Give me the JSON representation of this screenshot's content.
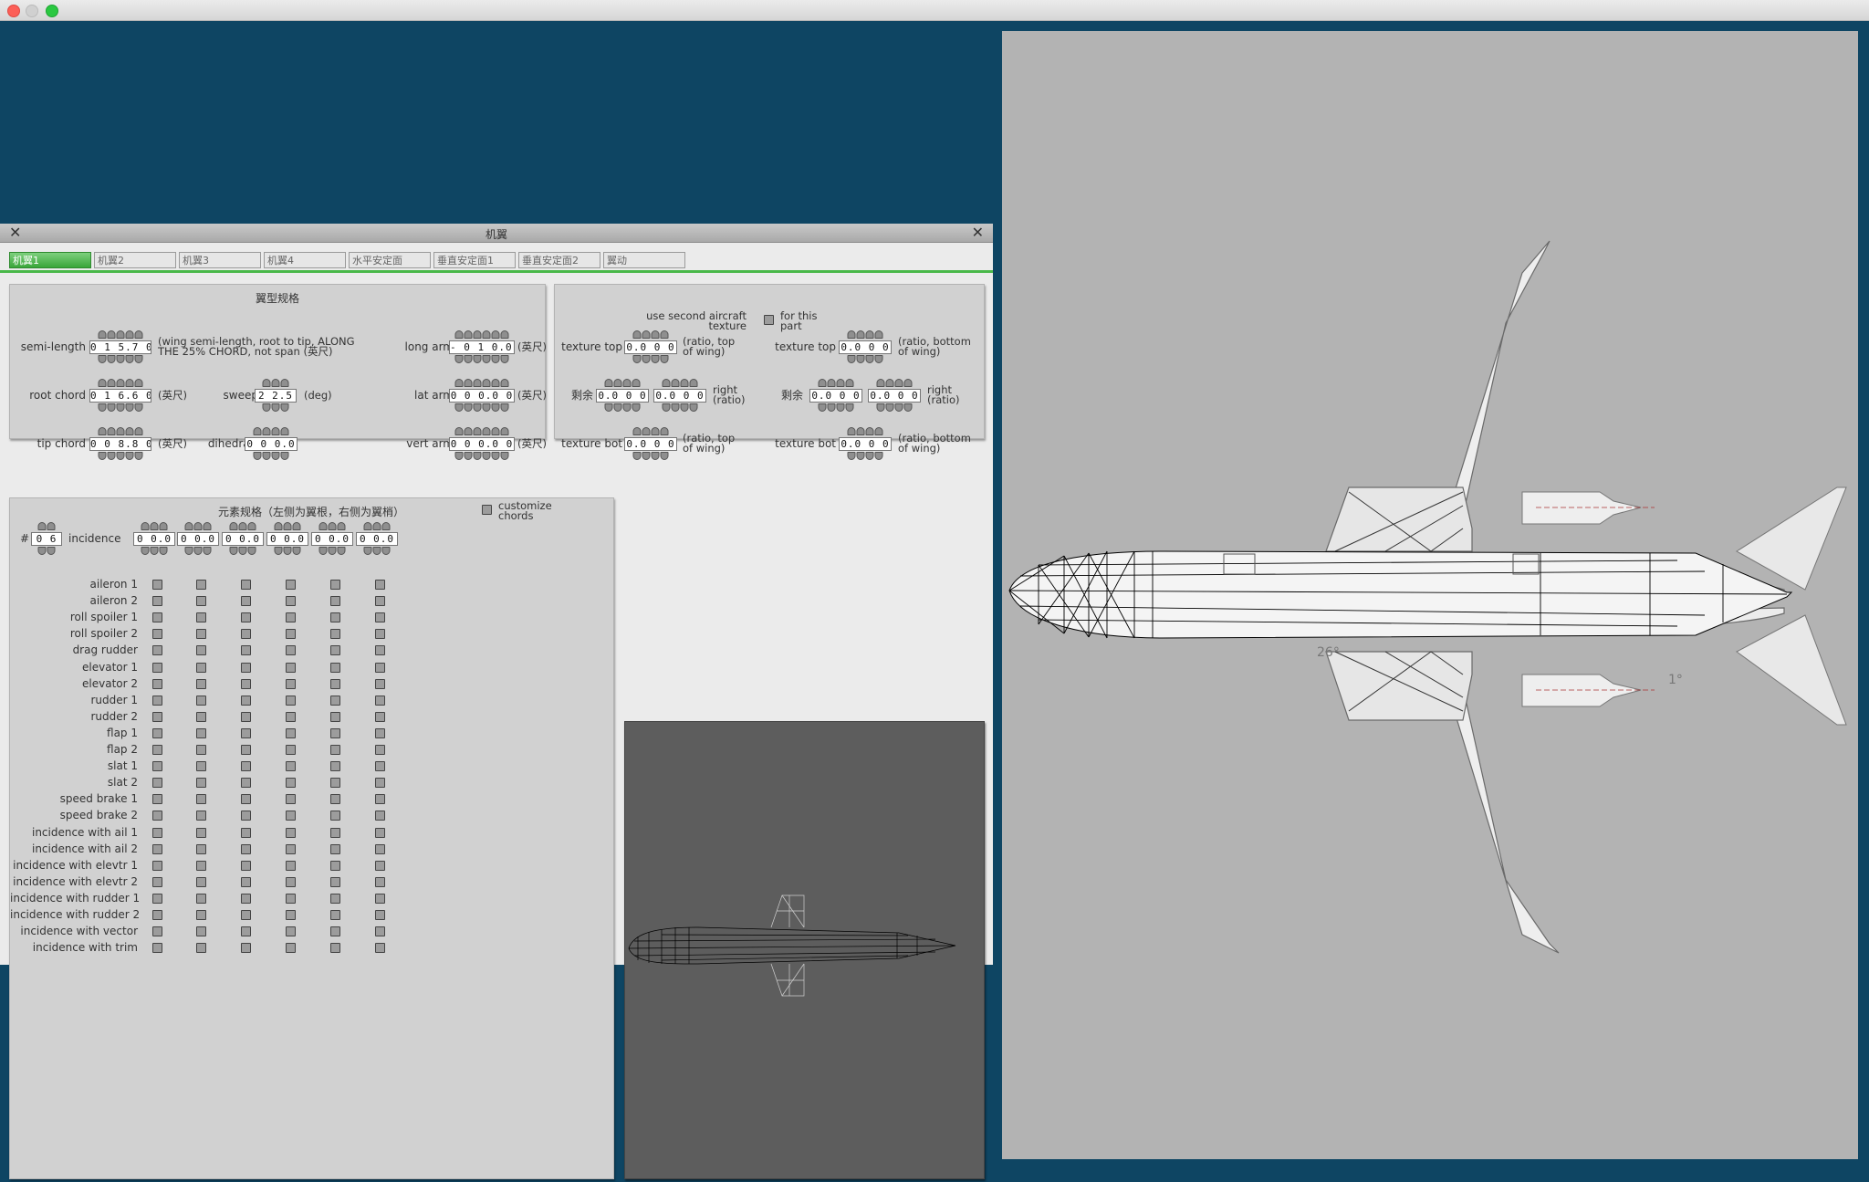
{
  "window": {
    "title": "机翼"
  },
  "tabs": [
    "机翼1",
    "机翼2",
    "机翼3",
    "机翼4",
    "水平安定面",
    "垂直安定面1",
    "垂直安定面2",
    "翼动"
  ],
  "airfoil_section": {
    "title": "翼型规格",
    "semi_length": {
      "label": "semi-length",
      "value": "0 1 5.7 0",
      "unit": "(wing semi-length, root to tip, ALONG THE 25% CHORD, not span (英尺)"
    },
    "root_chord": {
      "label": "root chord",
      "value": "0 1 6.6 0",
      "unit": "(英尺)"
    },
    "tip_chord": {
      "label": "tip chord",
      "value": "0 0 8.8 0",
      "unit": "(英尺)"
    },
    "sweep": {
      "label": "sweep",
      "value": "2 2.5",
      "unit": "(deg)"
    },
    "dihedral": {
      "label": "dihedral",
      "value": "0 0 0.0"
    },
    "long_arm": {
      "label": "long arm",
      "value": "- 0 1 0.0 0",
      "unit": "(英尺)"
    },
    "lat_arm": {
      "label": "lat arm",
      "value": "0 0 0.0 0",
      "unit": "(英尺)"
    },
    "vert_arm": {
      "label": "vert arm",
      "value": "0 0 0.0 0",
      "unit": "(英尺)"
    }
  },
  "texture_section": {
    "use_second_label": "use second aircraft texture",
    "for_this_part": "for this part",
    "texture_top_label": "texture top",
    "texture_top_left": "0.0 0 0",
    "texture_top_left_unit": "(ratio, top of wing)",
    "texture_top_right": "0.0 0 0",
    "texture_top_right_unit": "(ratio, bottom of wing)",
    "remainder_label": "剩余",
    "remainder_left_a": "0.0 0 0",
    "remainder_left_b": "0.0 0 0",
    "remainder_right_a": "0.0 0 0",
    "remainder_right_b": "0.0 0 0",
    "right_ratio": "right (ratio)",
    "texture_bot_label": "texture bot",
    "texture_bot_left": "0.0 0 0",
    "texture_bot_left_unit": "(ratio, top of wing)",
    "texture_bot_right": "0.0 0 0",
    "texture_bot_right_unit": "(ratio, bottom of wing)"
  },
  "elements_section": {
    "title": "元素规格（左侧为翼根，右侧为翼梢）",
    "customize_chords": "customize chords",
    "count_label": "#",
    "count_value": "0 6",
    "incidence_label": "incidence",
    "incidence_values": [
      "0 0.0",
      "0 0.0",
      "0 0.0",
      "0 0.0",
      "0 0.0",
      "0 0.0"
    ],
    "rows": [
      "aileron 1",
      "aileron 2",
      "roll spoiler 1",
      "roll spoiler 2",
      "drag rudder",
      "elevator 1",
      "elevator 2",
      "rudder 1",
      "rudder 2",
      "flap 1",
      "flap 2",
      "slat 1",
      "slat 2",
      "speed brake 1",
      "speed brake 2",
      "incidence with ail 1",
      "incidence with ail 2",
      "incidence with elevtr 1",
      "incidence with elevtr 2",
      "incidence with rudder 1",
      "incidence with rudder 2",
      "incidence with vector",
      "incidence with trim"
    ]
  },
  "aircraft_view": {
    "sweep_annotation": "26°",
    "dihedral_annotation": "1°"
  }
}
